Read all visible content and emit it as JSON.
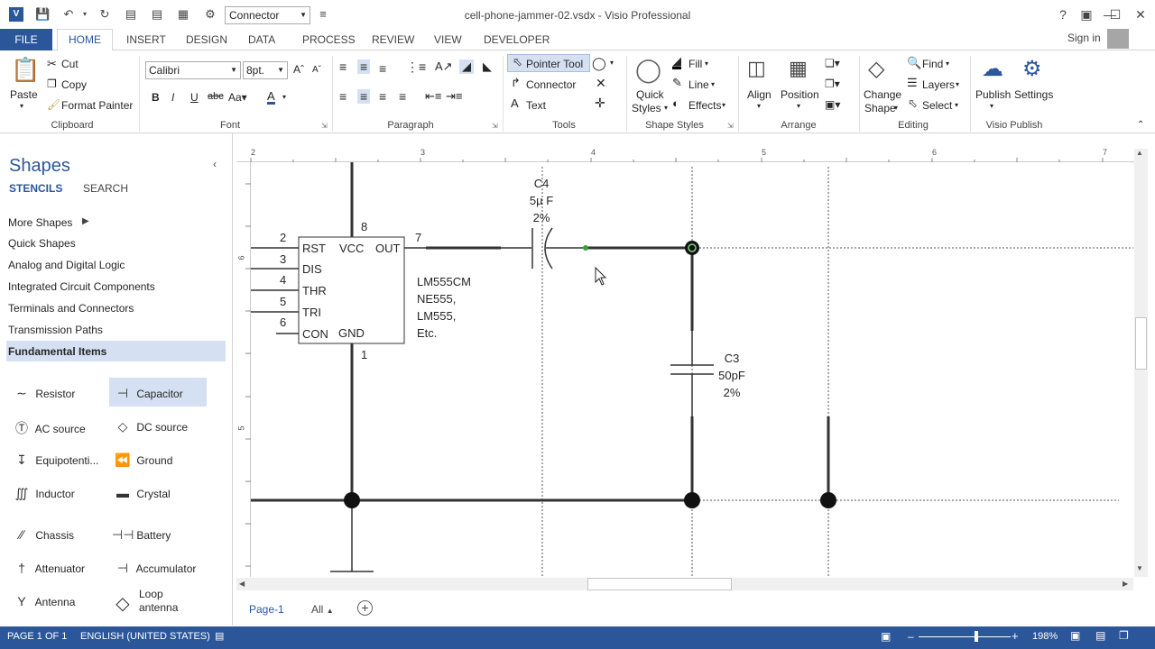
{
  "titlebar": {
    "app_icon": "V",
    "title": "cell-phone-jammer-02.vsdx - Visio Professional",
    "style_combo": "Connector"
  },
  "tabs": {
    "file": "FILE",
    "home": "HOME",
    "insert": "INSERT",
    "design": "DESIGN",
    "data": "DATA",
    "process": "PROCESS",
    "review": "REVIEW",
    "view": "VIEW",
    "developer": "DEVELOPER",
    "signin": "Sign in"
  },
  "ribbon": {
    "clipboard": {
      "paste": "Paste",
      "cut": "Cut",
      "copy": "Copy",
      "format_painter": "Format Painter",
      "label": "Clipboard"
    },
    "font": {
      "family": "Calibri",
      "size": "8pt.",
      "label": "Font"
    },
    "paragraph": {
      "label": "Paragraph"
    },
    "tools": {
      "pointer": "Pointer Tool",
      "connector": "Connector",
      "text": "Text",
      "label": "Tools"
    },
    "shape_styles": {
      "quick1": "Quick",
      "quick2": "Styles",
      "fill": "Fill",
      "line": "Line",
      "effects": "Effects",
      "label": "Shape Styles"
    },
    "arrange": {
      "align": "Align",
      "position": "Position",
      "label": "Arrange"
    },
    "editing": {
      "change1": "Change",
      "change2": "Shape",
      "find": "Find",
      "layers": "Layers",
      "select": "Select",
      "label": "Editing"
    },
    "visio_publish": {
      "publish": "Publish",
      "settings": "Settings",
      "label": "Visio Publish"
    }
  },
  "shapes_panel": {
    "title": "Shapes",
    "tab_stencils": "STENCILS",
    "tab_search": "SEARCH",
    "stencils": [
      "More Shapes",
      "Quick Shapes",
      "Analog and Digital Logic",
      "Integrated Circuit Components",
      "Terminals and Connectors",
      "Transmission Paths",
      "Fundamental Items"
    ],
    "items": [
      {
        "label": "Resistor",
        "icon": "resistor-icon"
      },
      {
        "label": "Capacitor",
        "icon": "capacitor-icon"
      },
      {
        "label": "AC source",
        "icon": "ac-source-icon"
      },
      {
        "label": "DC source",
        "icon": "dc-source-icon"
      },
      {
        "label": "Equipotenti...",
        "icon": "equipotential-icon"
      },
      {
        "label": "Ground",
        "icon": "ground-icon"
      },
      {
        "label": "Inductor",
        "icon": "inductor-icon"
      },
      {
        "label": "Crystal",
        "icon": "crystal-icon"
      },
      {
        "label": "Chassis",
        "icon": "chassis-icon"
      },
      {
        "label": "Battery",
        "icon": "battery-icon"
      },
      {
        "label": "Attenuator",
        "icon": "attenuator-icon"
      },
      {
        "label": "Accumulator",
        "icon": "accumulator-icon"
      },
      {
        "label": "Antenna",
        "icon": "antenna-icon"
      },
      {
        "label": "Loop antenna",
        "icon": "loop-antenna-icon"
      }
    ]
  },
  "diagram": {
    "ic_pins_left": [
      "RST",
      "DIS",
      "THR",
      "TRI",
      "CON"
    ],
    "ic_top": "VCC",
    "ic_out": "OUT",
    "ic_gnd": "GND",
    "pin_numbers": {
      "p2": "2",
      "p3": "3",
      "p4": "4",
      "p5": "5",
      "p6": "6",
      "p7": "7",
      "p8": "8",
      "p1": "1"
    },
    "ic_name": [
      "LM555CM",
      "NE555,",
      "LM555,",
      "Etc."
    ],
    "c4": [
      "C4",
      "5µ F",
      "2%"
    ],
    "c3": [
      "C3",
      "50pF",
      "2%"
    ]
  },
  "ruler": {
    "top": [
      "2",
      "3",
      "4",
      "5",
      "6",
      "7"
    ],
    "left": [
      "6",
      "5"
    ]
  },
  "page_tabs": {
    "page1": "Page-1",
    "all": "All"
  },
  "status": {
    "page": "PAGE 1 OF 1",
    "language": "ENGLISH (UNITED STATES)",
    "zoom": "198%"
  },
  "colors": {
    "accent": "#2b579a",
    "selection": "#d5e1f2"
  }
}
